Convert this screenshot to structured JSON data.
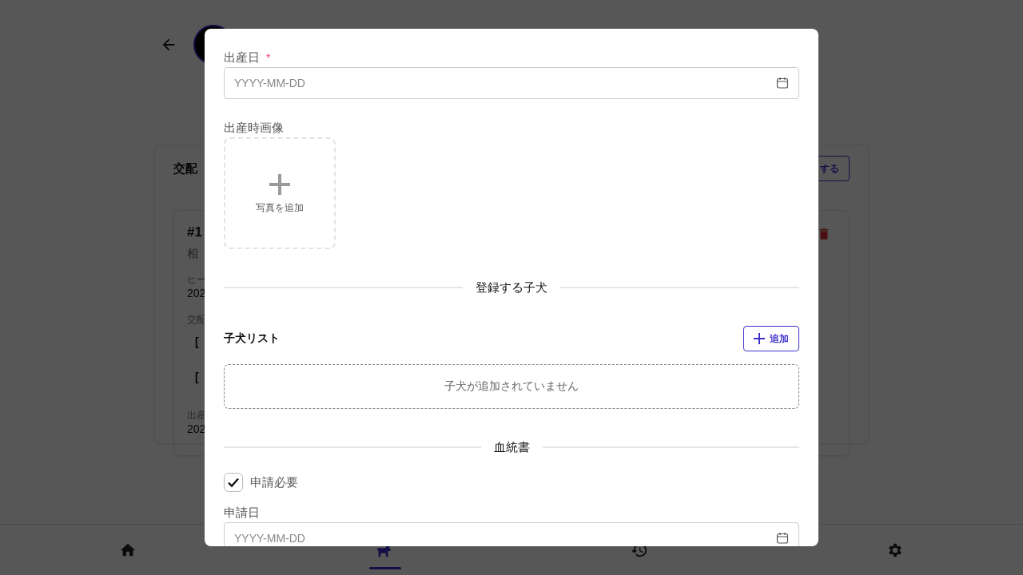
{
  "page": {
    "section_title": "交配",
    "header_button": "する",
    "card": {
      "title": "#1",
      "subtitle": "相",
      "fields": [
        {
          "kind": "value",
          "label": "ヒー",
          "value": "202"
        },
        {
          "kind": "items",
          "label": "交配",
          "items": [
            "[",
            "["
          ]
        },
        {
          "kind": "value",
          "label": "出産",
          "value": "202"
        }
      ]
    }
  },
  "modal": {
    "fields": [
      {
        "kind": "date",
        "label": "出産日",
        "required": true,
        "required_mark": "*",
        "placeholder": "YYYY-MM-DD"
      },
      {
        "kind": "upload",
        "label": "出産時画像",
        "button": "写真を追加"
      },
      {
        "kind": "divider",
        "label": "登録する子犬"
      },
      {
        "kind": "list",
        "label": "子犬リスト",
        "button": "追加",
        "empty": "子犬が追加されていません"
      },
      {
        "kind": "divider",
        "label": "血統書"
      },
      {
        "kind": "checkbox",
        "label": "申請必要",
        "checked": true
      },
      {
        "kind": "date",
        "label": "申請日",
        "required": false,
        "placeholder": "YYYY-MM-DD"
      }
    ]
  },
  "bottom_nav": [
    {
      "kind": "home",
      "selected": false
    },
    {
      "kind": "dog",
      "selected": true
    },
    {
      "kind": "history",
      "selected": false
    },
    {
      "kind": "settings",
      "selected": false
    }
  ]
}
